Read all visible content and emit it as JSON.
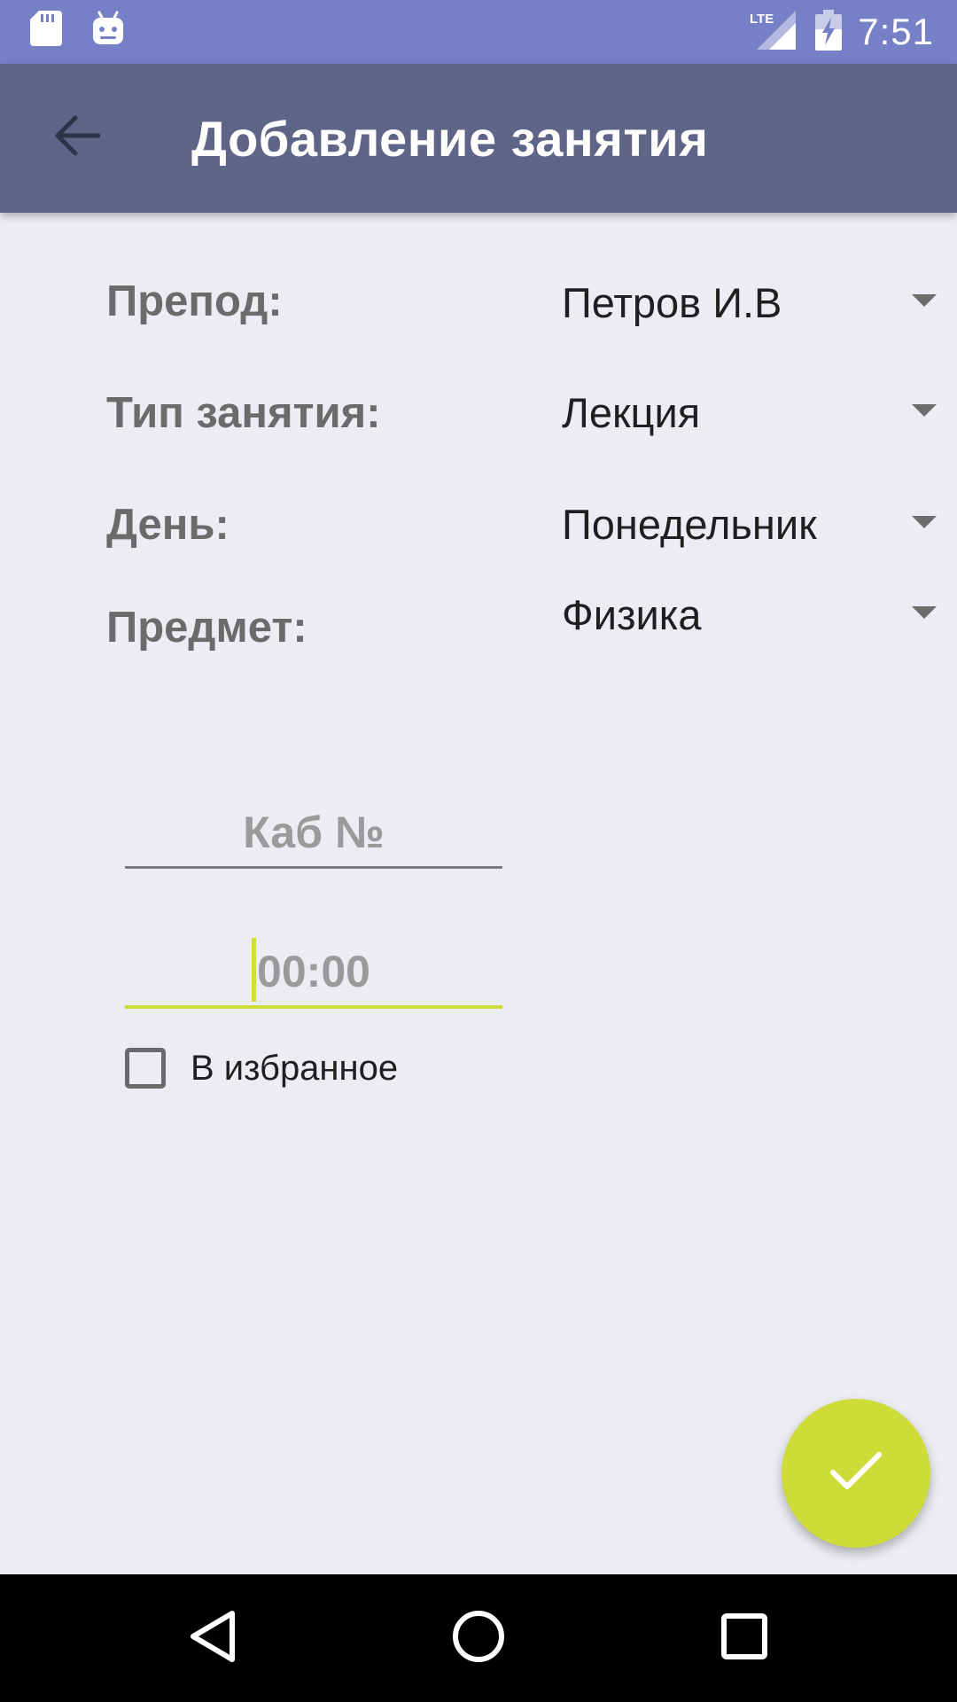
{
  "status_bar": {
    "time": "7:51",
    "network": "LTE",
    "icons": [
      "sd-card-icon",
      "android-icon",
      "lte-signal-icon",
      "battery-charging-icon"
    ]
  },
  "app_bar": {
    "title": "Добавление занятия",
    "back_icon": "arrow-back-icon"
  },
  "form": {
    "teacher": {
      "label": "Препод:",
      "value": "Петров И.В"
    },
    "lesson_type": {
      "label": "Тип занятия:",
      "value": "Лекция"
    },
    "day": {
      "label": "День:",
      "value": "Понедельник"
    },
    "subject": {
      "label": "Предмет:",
      "value": "Физика"
    },
    "room": {
      "placeholder": "Каб №",
      "value": ""
    },
    "time": {
      "placeholder": "00:00",
      "value": ""
    },
    "favorite": {
      "label": "В избранное",
      "checked": false
    }
  },
  "fab": {
    "icon": "check-icon"
  },
  "nav_bar": {
    "icons": [
      "back-triangle-icon",
      "home-circle-icon",
      "recents-square-icon"
    ]
  },
  "colors": {
    "status_bar": "#7580C7",
    "app_bar": "#5E6586",
    "background": "#ECEDF2",
    "accent": "#CDDC39"
  }
}
